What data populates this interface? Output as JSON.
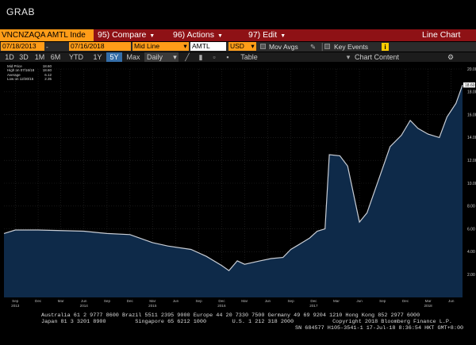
{
  "window": {
    "title": "GRAB"
  },
  "toolbar": {
    "security": "VNCNZAQA AMTL Inde",
    "compare": "95) Compare",
    "actions": "96) Actions",
    "edit": "97) Edit",
    "view_label": "Line Chart"
  },
  "controls": {
    "start_date": "07/18/2013",
    "end_date": "07/16/2018",
    "line_mode": "Mid Line",
    "ticker": "AMTL",
    "currency": "USD",
    "mov_avgs": "Mov Avgs",
    "key_events": "Key Events",
    "info_icon": "i"
  },
  "periods": {
    "items": [
      "1D",
      "3D",
      "1M",
      "6M",
      "YTD",
      "1Y",
      "5Y",
      "Max"
    ],
    "active": "5Y",
    "frequency": "Daily",
    "table": "Table",
    "chart_content": "Chart Content"
  },
  "legend": {
    "rows": [
      {
        "label": "Mid Price",
        "value": "18.60"
      },
      {
        "label": "High on 07/16/18",
        "value": "18.60"
      },
      {
        "label": "Average",
        "value": "6.12"
      },
      {
        "label": "Low on 12/30/15",
        "value": "2.35"
      }
    ],
    "last_value_tag": "18.60"
  },
  "chart_data": {
    "type": "area",
    "title": "",
    "xlabel": "",
    "ylabel": "",
    "ylim": [
      0,
      20
    ],
    "y_ticks": [
      "2.00",
      "4.00",
      "6.00",
      "8.00",
      "10.00",
      "12.00",
      "14.00",
      "16.00",
      "18.00",
      "20.00"
    ],
    "x_tick_labels": [
      "Sep",
      "Dec",
      "Mar",
      "Jun",
      "Sep",
      "Dec",
      "Mar",
      "Jun",
      "Sep",
      "Dec",
      "Mar",
      "Jun",
      "Sep",
      "Dec",
      "Mar",
      "Jun",
      "Sep",
      "Dec",
      "Mar",
      "Jun"
    ],
    "year_labels": [
      "2013",
      "2014",
      "2015",
      "2016",
      "2017",
      "2018"
    ],
    "series": [
      {
        "values": [
          {
            "x": "2013-07-18",
            "y": 5.6
          },
          {
            "x": "2013-09-01",
            "y": 5.9
          },
          {
            "x": "2013-12-01",
            "y": 5.9
          },
          {
            "x": "2014-06-01",
            "y": 5.8
          },
          {
            "x": "2014-09-01",
            "y": 5.6
          },
          {
            "x": "2014-12-01",
            "y": 5.5
          },
          {
            "x": "2015-03-01",
            "y": 4.8
          },
          {
            "x": "2015-05-01",
            "y": 4.5
          },
          {
            "x": "2015-08-01",
            "y": 4.2
          },
          {
            "x": "2015-10-01",
            "y": 3.6
          },
          {
            "x": "2015-12-01",
            "y": 2.8
          },
          {
            "x": "2015-12-30",
            "y": 2.35
          },
          {
            "x": "2016-02-01",
            "y": 3.2
          },
          {
            "x": "2016-03-01",
            "y": 2.9
          },
          {
            "x": "2016-05-01",
            "y": 3.2
          },
          {
            "x": "2016-06-15",
            "y": 3.4
          },
          {
            "x": "2016-08-01",
            "y": 3.5
          },
          {
            "x": "2016-09-01",
            "y": 4.2
          },
          {
            "x": "2016-10-01",
            "y": 4.6
          },
          {
            "x": "2016-11-15",
            "y": 5.2
          },
          {
            "x": "2016-12-15",
            "y": 5.8
          },
          {
            "x": "2017-01-15",
            "y": 6.0
          },
          {
            "x": "2017-02-01",
            "y": 12.5
          },
          {
            "x": "2017-03-15",
            "y": 12.4
          },
          {
            "x": "2017-04-15",
            "y": 11.5
          },
          {
            "x": "2017-06-01",
            "y": 6.6
          },
          {
            "x": "2017-07-01",
            "y": 7.4
          },
          {
            "x": "2017-09-01",
            "y": 11.3
          },
          {
            "x": "2017-10-01",
            "y": 13.2
          },
          {
            "x": "2017-11-15",
            "y": 14.2
          },
          {
            "x": "2017-12-20",
            "y": 15.5
          },
          {
            "x": "2018-01-20",
            "y": 14.8
          },
          {
            "x": "2018-03-01",
            "y": 14.3
          },
          {
            "x": "2018-04-15",
            "y": 14.0
          },
          {
            "x": "2018-05-15",
            "y": 15.8
          },
          {
            "x": "2018-06-20",
            "y": 17.0
          },
          {
            "x": "2018-07-16",
            "y": 18.6
          }
        ]
      }
    ],
    "colors": {
      "area": "#0e2a49",
      "line": "#c9ced6",
      "background": "#000000",
      "label_tag": "#ffffff"
    }
  },
  "footer": {
    "line1": "Australia 61 2 9777 8600 Brazil 5511 2395 9000 Europe 44 20 7330 7500 Germany 49 69 9204 1210 Hong Kong 852 2977 6000",
    "line2": "Japan 81 3 3201 8900         Singapore 65 6212 1000        U.S. 1 212 318 2000            Copyright 2018 Bloomberg Finance L.P.",
    "line3": "SN 684577 H105-3541-1 17-Jul-18  8:36:54 HKT  GMT+8:00"
  }
}
